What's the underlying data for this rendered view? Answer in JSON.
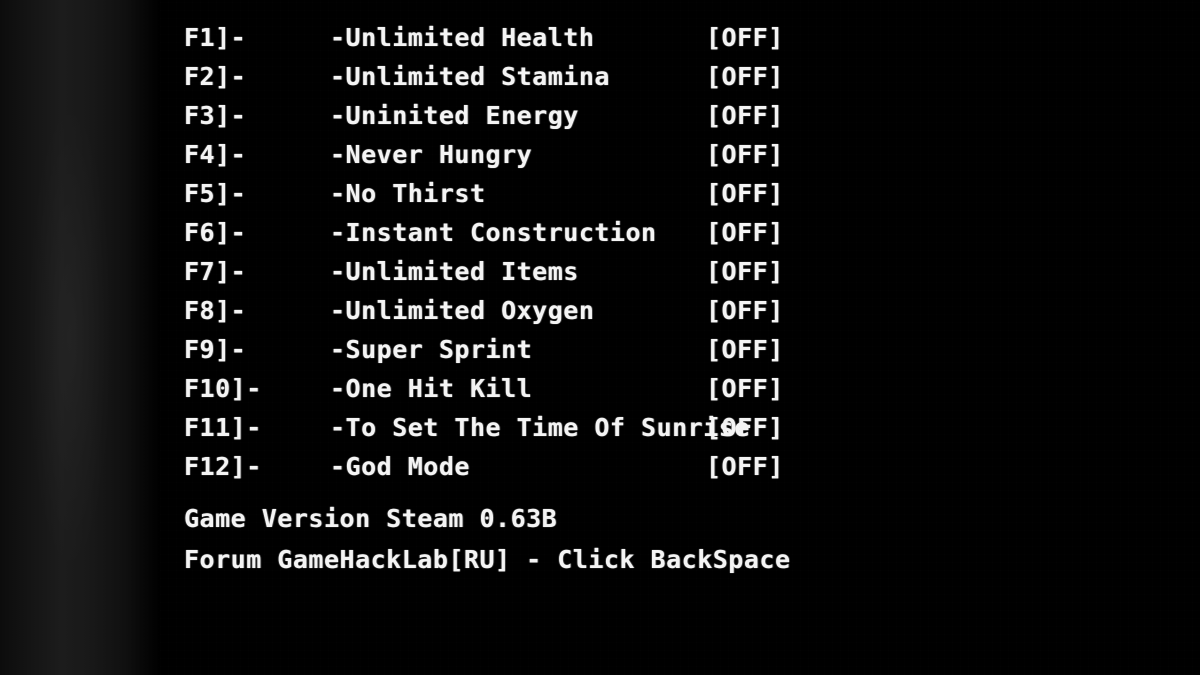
{
  "overlay": {
    "background_color": "#000000",
    "text_color": "#f4f4f4",
    "left_edge_glow_color": "#1c1c1c"
  },
  "cheats": [
    {
      "key": "F1]-",
      "label": "-Unlimited Health",
      "state": "[OFF]"
    },
    {
      "key": "F2]-",
      "label": "-Unlimited Stamina",
      "state": "[OFF]"
    },
    {
      "key": "F3]-",
      "label": "-Uninited Energy",
      "state": "[OFF]"
    },
    {
      "key": "F4]-",
      "label": "-Never Hungry",
      "state": "[OFF]"
    },
    {
      "key": "F5]-",
      "label": "-No Thirst",
      "state": "[OFF]"
    },
    {
      "key": "F6]-",
      "label": "-Instant Construction",
      "state": "[OFF]"
    },
    {
      "key": "F7]-",
      "label": "-Unlimited Items",
      "state": "[OFF]"
    },
    {
      "key": "F8]-",
      "label": "-Unlimited Oxygen",
      "state": "[OFF]"
    },
    {
      "key": "F9]-",
      "label": "-Super Sprint",
      "state": "[OFF]"
    },
    {
      "key": "F10]-",
      "label": "-One Hit Kill",
      "state": "[OFF]"
    },
    {
      "key": "F11]-",
      "label": "-To Set The Time Of Sunrise",
      "state": "[OFF]"
    },
    {
      "key": "F12]-",
      "label": "-God Mode",
      "state": "[OFF]"
    }
  ],
  "footer": {
    "game_version": "Game Version Steam 0.63B",
    "forum_line": "Forum GameHackLab[RU] - Click BackSpace"
  }
}
